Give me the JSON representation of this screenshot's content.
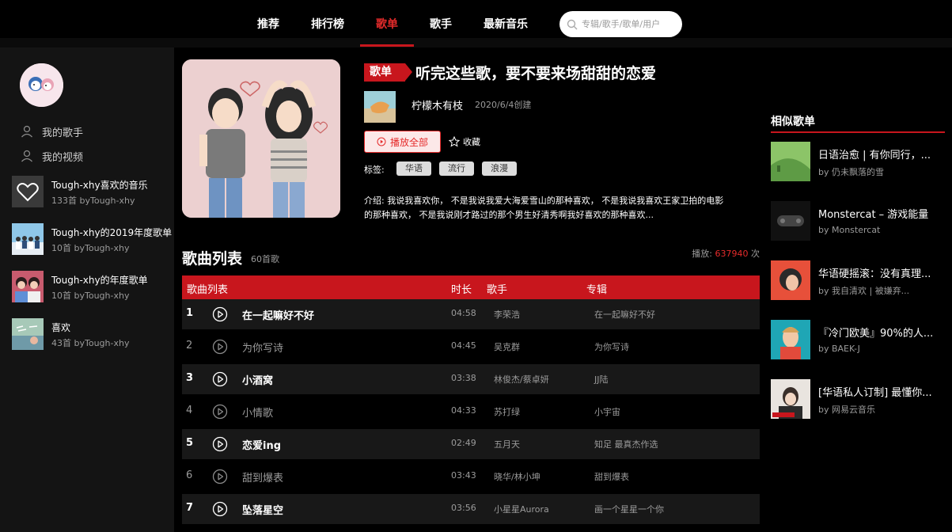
{
  "nav": {
    "items": [
      "推荐",
      "排行榜",
      "歌单",
      "歌手",
      "最新音乐"
    ],
    "active": "歌单",
    "search_placeholder": "专辑/歌手/歌单/用户"
  },
  "sidebar": {
    "links": [
      "我的歌手",
      "我的视频"
    ],
    "playlists": [
      {
        "name": "Tough-xhy喜欢的音乐",
        "sub": "133首 byTough-xhy"
      },
      {
        "name": "Tough-xhy的2019年度歌单",
        "sub": "10首 byTough-xhy"
      },
      {
        "name": "Tough-xhy的年度歌单",
        "sub": "10首 byTough-xhy"
      },
      {
        "name": "喜欢",
        "sub": "43首 byTough-xhy"
      }
    ]
  },
  "playlist": {
    "badge": "歌单",
    "title": "听完这些歌，要不要来场甜甜的恋爱",
    "creator": "柠檬木有枝",
    "created": "2020/6/4创建",
    "play_all": "播放全部",
    "collect": "收藏",
    "tags_label": "标签:",
    "tags": [
      "华语",
      "流行",
      "浪漫"
    ],
    "intro": "介绍: 我说我喜欢你， 不是我说我爱大海爱雪山的那种喜欢， 不是我说我喜欢王家卫拍的电影的那种喜欢， 不是我说刚才路过的那个男生好清秀啊我好喜欢的那种喜欢..."
  },
  "songlist": {
    "title": "歌曲列表",
    "count": "60首歌",
    "play_prefix": "播放:",
    "play_count": "637940",
    "play_suffix": "次",
    "headers": {
      "name": "歌曲列表",
      "duration": "时长",
      "singer": "歌手",
      "album": "专辑"
    },
    "rows": [
      {
        "idx": "1",
        "song": "在一起嘛好不好",
        "dur": "04:58",
        "singer": "李荣浩",
        "album": "在一起嘛好不好"
      },
      {
        "idx": "2",
        "song": "为你写诗",
        "dur": "04:45",
        "singer": "吴克群",
        "album": "为你写诗"
      },
      {
        "idx": "3",
        "song": "小酒窝",
        "dur": "03:38",
        "singer": "林俊杰/蔡卓妍",
        "album": "JJ陆"
      },
      {
        "idx": "4",
        "song": "小情歌",
        "dur": "04:33",
        "singer": "苏打绿",
        "album": "小宇宙"
      },
      {
        "idx": "5",
        "song": "恋爱ing",
        "dur": "02:49",
        "singer": "五月天",
        "album": "知足 最真杰作选"
      },
      {
        "idx": "6",
        "song": "甜到爆表",
        "dur": "03:43",
        "singer": "晓华/林小坤",
        "album": "甜到爆表"
      },
      {
        "idx": "7",
        "song": "坠落星空",
        "dur": "03:56",
        "singer": "小星星Aurora",
        "album": "画一个星星一个你"
      }
    ]
  },
  "similar": {
    "title": "相似歌单",
    "items": [
      {
        "name": "日语治愈 | 有你同行，...",
        "by": "by 仍未飘落的雪"
      },
      {
        "name": "Monstercat – 游戏能量",
        "by": "by Monstercat"
      },
      {
        "name": "华语硬摇滚：没有真理...",
        "by": "by 我自清欢 | 被嫌弃..."
      },
      {
        "name": "『冷门欧美』90%的人...",
        "by": "by BAEK-J"
      },
      {
        "name": "[华语私人订制] 最懂你...",
        "by": "by 网易云音乐"
      }
    ]
  },
  "colors": {
    "accent": "#c8161d",
    "accent_text": "#e52b2b"
  }
}
